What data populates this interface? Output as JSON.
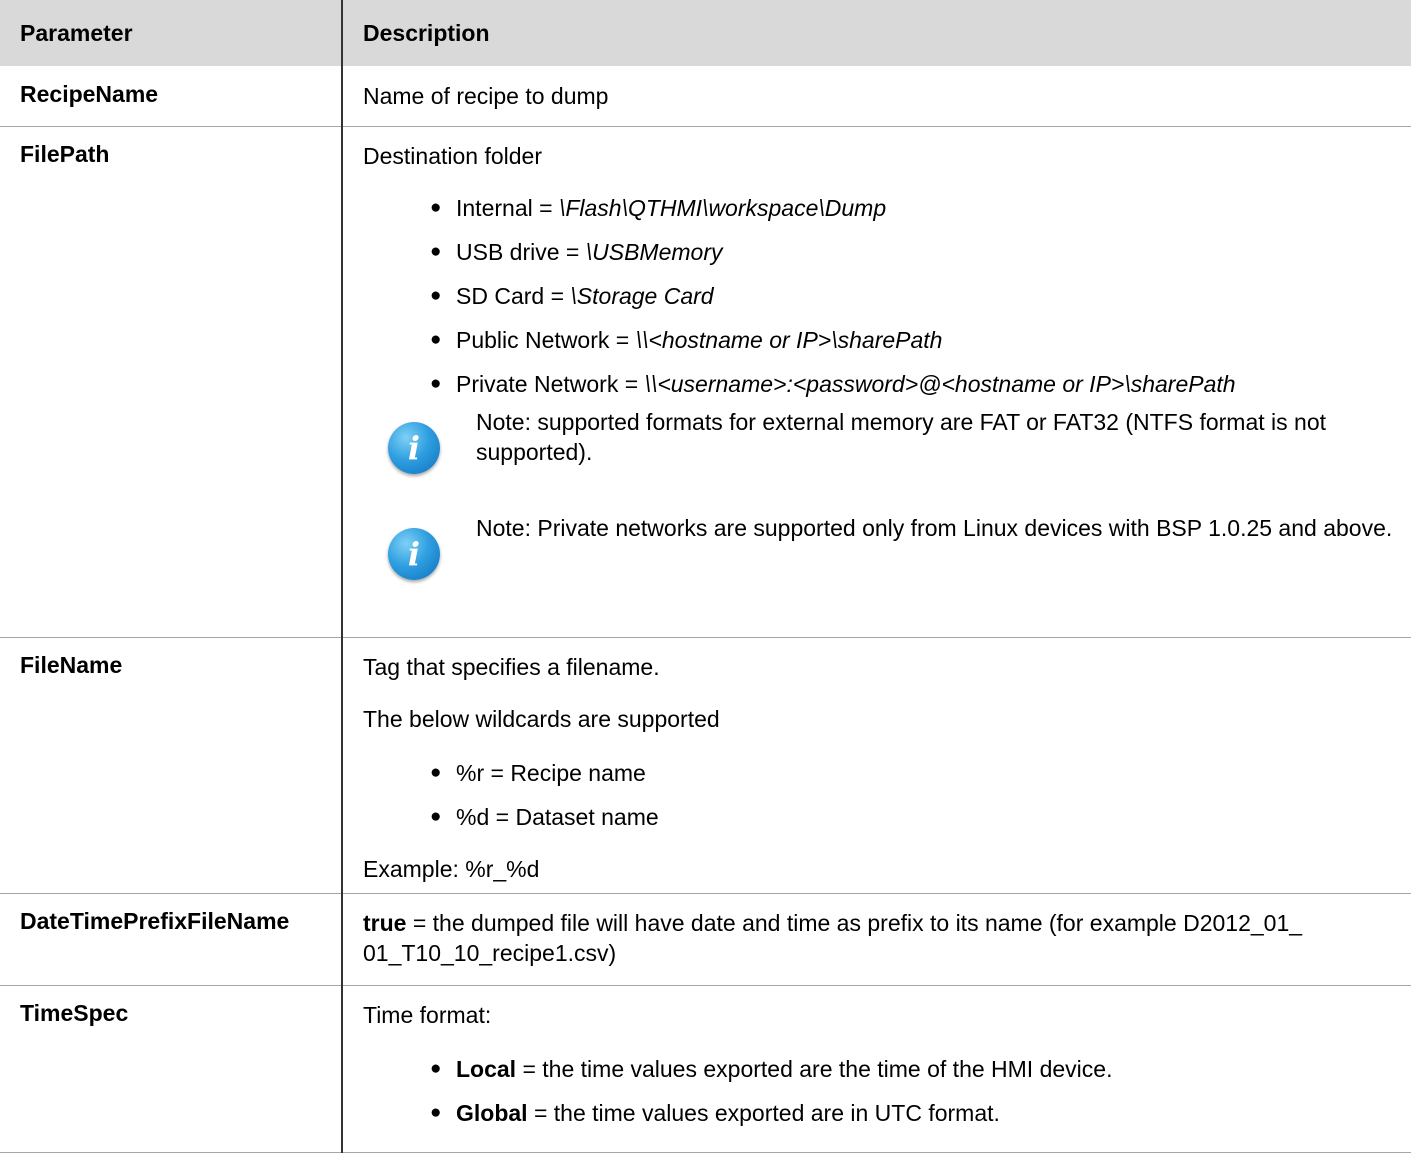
{
  "headers": {
    "parameter": "Parameter",
    "description": "Description"
  },
  "rows": {
    "recipe_name": {
      "name": "RecipeName",
      "desc": "Name of recipe to dump"
    },
    "file_path": {
      "name": "FilePath",
      "intro": "Destination folder",
      "items": [
        {
          "label": "Internal = ",
          "value": "\\Flash\\QTHMI\\workspace\\Dump"
        },
        {
          "label": "USB drive = ",
          "value": "\\USBMemory"
        },
        {
          "label": "SD Card = ",
          "value": "\\Storage Card"
        },
        {
          "label": "Public Network = ",
          "value": "\\\\<hostname or IP>\\sharePath"
        },
        {
          "label": "Private Network = ",
          "value": "\\\\<username>:<password>@<hostname or IP>\\sharePath"
        }
      ],
      "notes": [
        {
          "icon": "info-icon",
          "text": "Note: supported formats for external memory are FAT or FAT32 (NTFS format is not supported)."
        },
        {
          "icon": "info-icon",
          "text": "Note: Private networks are supported only from Linux devices with BSP 1.0.25 and above."
        }
      ]
    },
    "file_name": {
      "name": "FileName",
      "intro": "Tag that specifies a filename.",
      "wildcards_intro": "The below wildcards are supported",
      "items": [
        "%r = Recipe name",
        "%d = Dataset name"
      ],
      "example": "Example: %r_%d"
    },
    "date_time_prefix": {
      "name": "DateTimePrefixFileName",
      "keyword": "true",
      "desc_line1": " = the dumped file will have date and time as prefix to its name (for example D2012_01_",
      "desc_line2": "01_T10_10_recipe1.csv)"
    },
    "time_spec": {
      "name": "TimeSpec",
      "intro": "Time format:",
      "items": [
        {
          "keyword": "Local",
          "text": " = the time values exported are the time of the HMI device."
        },
        {
          "keyword": "Global",
          "text": " = the time values exported are in UTC format."
        }
      ]
    }
  },
  "icon_glyph": "i",
  "bullet_glyph": "●"
}
